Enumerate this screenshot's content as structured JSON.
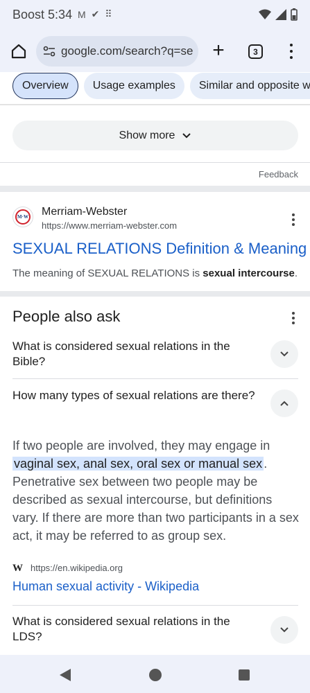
{
  "status": {
    "carrier": "Boost",
    "time": "5:34"
  },
  "browser": {
    "url": "google.com/search?q=se",
    "tab_count": "3"
  },
  "chips": [
    "Overview",
    "Usage examples",
    "Similar and opposite wo"
  ],
  "show_more": "Show more",
  "feedback": "Feedback",
  "result": {
    "source_name": "Merriam-Webster",
    "source_url": "https://www.merriam-webster.com",
    "logo_text": "M·W",
    "title": "SEXUAL RELATIONS Definition & Meaning",
    "snippet_prefix": "The meaning of SEXUAL RELATIONS is ",
    "snippet_bold": "sexual intercourse",
    "snippet_suffix": "."
  },
  "paa": {
    "title": "People also ask",
    "questions": [
      "What is considered sexual relations in the Bible?",
      "How many types of sexual relations are there?",
      "What is considered sexual relations in the LDS?"
    ],
    "answer": {
      "before": "If two people are involved, they may engage in ",
      "highlight": "vaginal sex, anal sex, oral sex or manual sex",
      "after": ". Penetrative sex between two people may be described as sexual intercourse, but definitions vary. If there are more than two participants in a sex act, it may be referred to as group sex."
    },
    "source_url": "https://en.wikipedia.org",
    "source_link": "Human sexual activity - Wikipedia"
  }
}
